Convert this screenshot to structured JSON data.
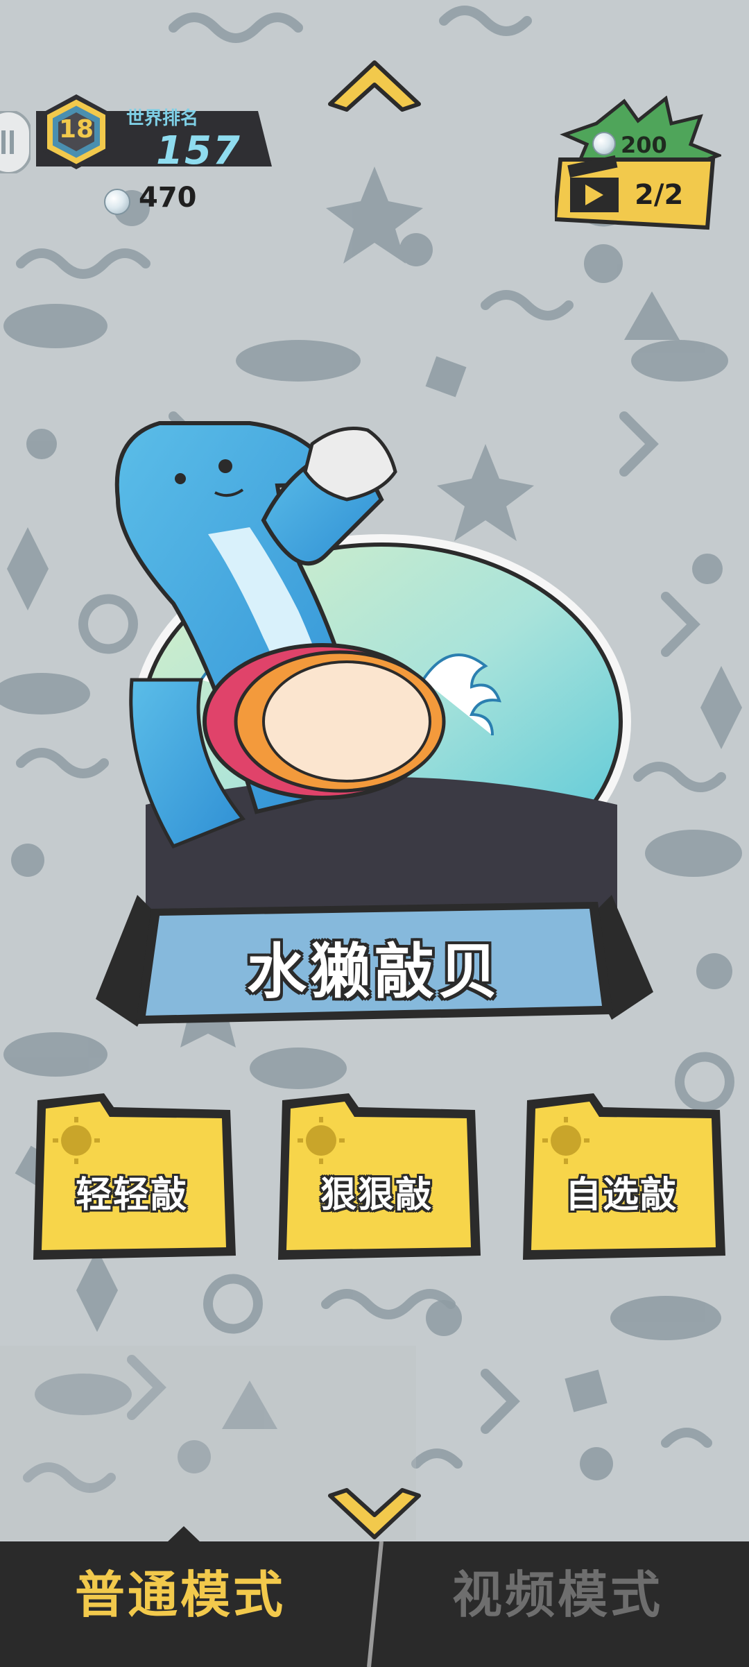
{
  "hud": {
    "level": "18",
    "rank_title": "世界排名",
    "rank_value": "157",
    "pearl_count": "470"
  },
  "reward": {
    "amount": "200",
    "video_counter": "2/2"
  },
  "title": "水獭敲贝",
  "options": [
    {
      "label": "轻轻敲"
    },
    {
      "label": "狠狠敲"
    },
    {
      "label": "自选敲"
    }
  ],
  "tabs": {
    "normal": "普通模式",
    "video": "视频模式",
    "active": "normal"
  },
  "colors": {
    "background": "#c5cbce",
    "pattern": "#8e9ca3",
    "banner_blue": "#86b9dc",
    "button_yellow": "#f7d54a",
    "active_tab": "#f2c94c",
    "inactive_tab": "#6e6e6e",
    "bottom_bar": "#2a2a2a"
  }
}
